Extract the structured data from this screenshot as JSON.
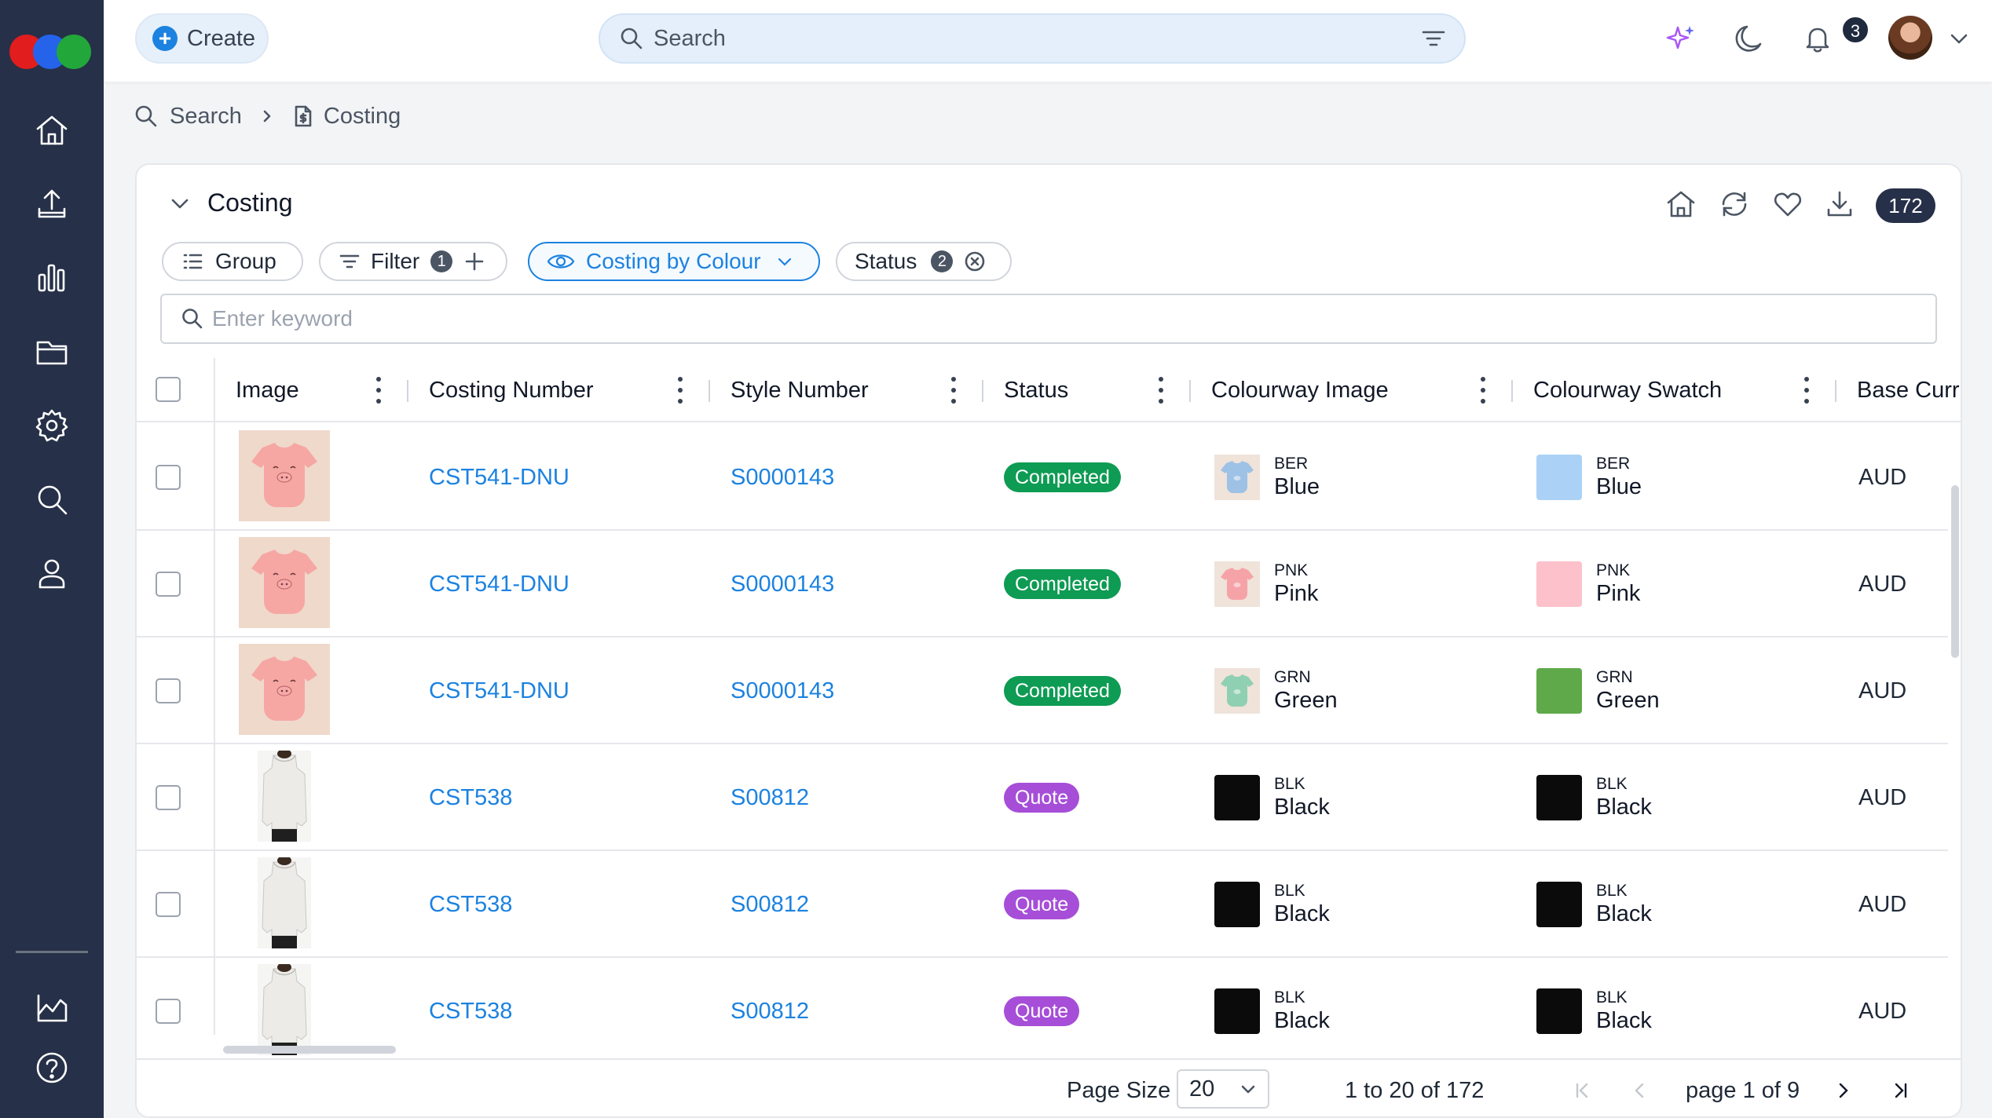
{
  "colors": {
    "sidebar": "#263048",
    "accent": "#1c82e0",
    "completed": "#0e9b53",
    "quote": "#a64ed8"
  },
  "topbar": {
    "create_label": "Create",
    "search_placeholder": "Search",
    "notifications_count": "3"
  },
  "sidebar": {
    "items": [
      "home-icon",
      "upload-icon",
      "chart-icon",
      "folder-icon",
      "settings-icon",
      "search-icon",
      "user-icon",
      "analytics-icon",
      "help-icon"
    ]
  },
  "breadcrumb": {
    "items": [
      "Search",
      "Costing"
    ]
  },
  "card": {
    "title": "Costing",
    "total_count": "172",
    "toolbar": {
      "group_label": "Group",
      "filter_label": "Filter",
      "filter_count": "1",
      "view_label": "Costing by Colour",
      "status_label": "Status",
      "status_count": "2"
    },
    "keyword_placeholder": "Enter keyword",
    "columns": [
      "Image",
      "Costing Number",
      "Style Number",
      "Status",
      "Colourway Image",
      "Colourway Swatch",
      "Base Curr"
    ],
    "rows": [
      {
        "costing_number": "CST541-DNU",
        "style_number": "S0000143",
        "status": "Completed",
        "cw_code": "BER",
        "cw_name": "Blue",
        "swatch_code": "BER",
        "swatch_name": "Blue",
        "swatch_color": "#abd2f6",
        "currency": "AUD",
        "product": "onesie"
      },
      {
        "costing_number": "CST541-DNU",
        "style_number": "S0000143",
        "status": "Completed",
        "cw_code": "PNK",
        "cw_name": "Pink",
        "swatch_code": "PNK",
        "swatch_name": "Pink",
        "swatch_color": "#fcc1ca",
        "currency": "AUD",
        "product": "onesie"
      },
      {
        "costing_number": "CST541-DNU",
        "style_number": "S0000143",
        "status": "Completed",
        "cw_code": "GRN",
        "cw_name": "Green",
        "swatch_code": "GRN",
        "swatch_name": "Green",
        "swatch_color": "#5fa94b",
        "currency": "AUD",
        "product": "onesie"
      },
      {
        "costing_number": "CST538",
        "style_number": "S00812",
        "status": "Quote",
        "cw_code": "BLK",
        "cw_name": "Black",
        "swatch_code": "BLK",
        "swatch_name": "Black",
        "swatch_color": "#0b0b0b",
        "currency": "AUD",
        "product": "sweater"
      },
      {
        "costing_number": "CST538",
        "style_number": "S00812",
        "status": "Quote",
        "cw_code": "BLK",
        "cw_name": "Black",
        "swatch_code": "BLK",
        "swatch_name": "Black",
        "swatch_color": "#0b0b0b",
        "currency": "AUD",
        "product": "sweater"
      },
      {
        "costing_number": "CST538",
        "style_number": "S00812",
        "status": "Quote",
        "cw_code": "BLK",
        "cw_name": "Black",
        "swatch_code": "BLK",
        "swatch_name": "Black",
        "swatch_color": "#0b0b0b",
        "currency": "AUD",
        "product": "sweater"
      }
    ]
  },
  "footer": {
    "page_size_label": "Page Size",
    "page_size_value": "20",
    "range_text": "1 to 20 of 172",
    "page_text": "page 1 of 9"
  }
}
